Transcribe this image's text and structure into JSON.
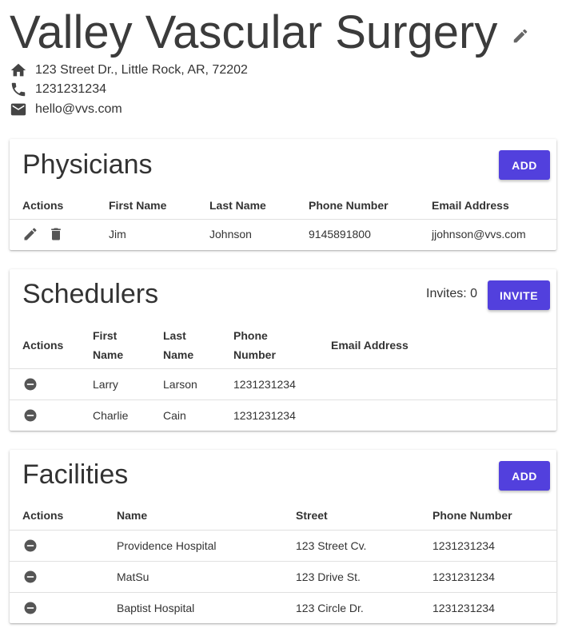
{
  "header": {
    "title": "Valley Vascular Surgery",
    "address": "123 Street Dr., Little Rock, AR, 72202",
    "phone": "1231231234",
    "email": "hello@vvs.com"
  },
  "physicians": {
    "title": "Physicians",
    "add_label": "ADD",
    "columns": [
      "Actions",
      "First Name",
      "Last Name",
      "Phone Number",
      "Email Address"
    ],
    "rows": [
      {
        "first": "Jim",
        "last": "Johnson",
        "phone": "9145891800",
        "email": "jjohnson@vvs.com"
      }
    ]
  },
  "schedulers": {
    "title": "Schedulers",
    "invites_text": "Invites: 0",
    "invite_label": "INVITE",
    "columns": {
      "actions": "Actions",
      "first_1": "First",
      "first_2": "Name",
      "last_1": "Last",
      "last_2": "Name",
      "phone_1": "Phone",
      "phone_2": "Number",
      "email": "Email Address"
    },
    "rows": [
      {
        "first": "Larry",
        "last": "Larson",
        "phone": "1231231234",
        "email": ""
      },
      {
        "first": "Charlie",
        "last": "Cain",
        "phone": "1231231234",
        "email": ""
      }
    ]
  },
  "facilities": {
    "title": "Facilities",
    "add_label": "ADD",
    "columns": [
      "Actions",
      "Name",
      "Street",
      "Phone Number"
    ],
    "rows": [
      {
        "name": "Providence Hospital",
        "street": "123 Street Cv.",
        "phone": "1231231234"
      },
      {
        "name": "MatSu",
        "street": "123 Drive St.",
        "phone": "1231231234"
      },
      {
        "name": "Baptist Hospital",
        "street": "123 Circle Dr.",
        "phone": "1231231234"
      }
    ]
  },
  "colors": {
    "accent": "#5240dd",
    "icon": "#555555"
  }
}
